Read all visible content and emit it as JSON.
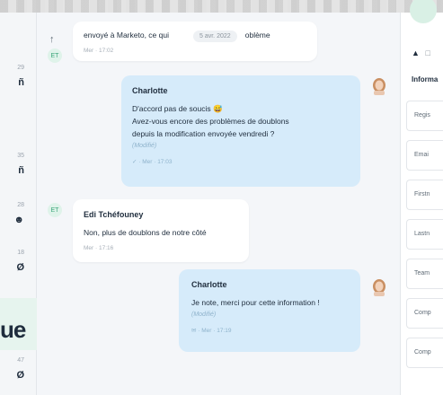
{
  "chat": {
    "date_divider": "5 avr. 2022",
    "messages": [
      {
        "id": "m1",
        "direction": "in",
        "avatar_initials": "ET",
        "lines": [
          "envoyé à Marketo, ce qui",
          "oblème"
        ],
        "meta": "Mer · 17:02"
      },
      {
        "id": "m2",
        "direction": "out",
        "author": "Charlotte",
        "lines": [
          "D'accord pas de soucis 😅",
          "Avez-vous encore des problèmes de doublons",
          "depuis la modification envoyée vendredi ?"
        ],
        "modified": "(Modifié)",
        "meta": "✓ · Mer · 17:03"
      },
      {
        "id": "m3",
        "direction": "in",
        "avatar_initials": "ET",
        "author": "Edi Tchéfouney",
        "lines": [
          "Non, plus de doublons de notre côté"
        ],
        "meta": "Mer · 17:16"
      },
      {
        "id": "m4",
        "direction": "out",
        "author": "Charlotte",
        "lines": [
          "Je note, merci pour cette information !"
        ],
        "modified": "(Modifié)",
        "meta": "✉ · Mer · 17:19"
      }
    ]
  },
  "left_strip": {
    "rows": [
      {
        "time": "29",
        "glyph": "ñ"
      },
      {
        "time": "35",
        "glyph": "ñ"
      },
      {
        "time": "28",
        "glyph": "☻"
      },
      {
        "time": "18",
        "glyph": "Ø"
      },
      {
        "time": "47",
        "glyph": "Ø"
      }
    ],
    "partial_text": "ue"
  },
  "right_panel": {
    "section_title": "Informa",
    "icons": [
      "person-icon",
      "calendar-icon"
    ],
    "fields": [
      "Regis",
      "Emai",
      "Firstn",
      "Lastn",
      "Team",
      "Comp",
      "Comp"
    ]
  },
  "colors": {
    "accent": "#3aa57a",
    "outgoing_bubble": "#d6ebfa",
    "incoming_bubble": "#ffffff",
    "chat_bg": "#f4f6f9"
  }
}
